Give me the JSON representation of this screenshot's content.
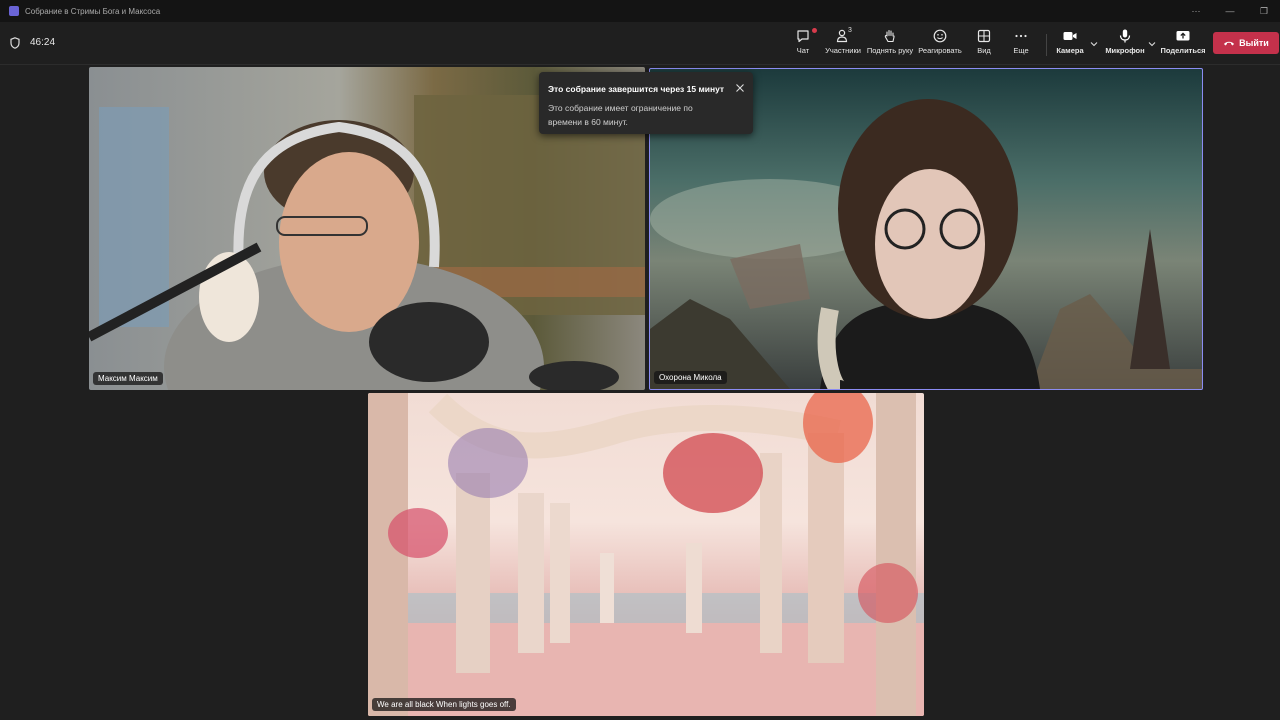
{
  "window": {
    "title": "Собрание в Стримы Бога и Максоса",
    "controls": [
      "···",
      "—",
      "❐"
    ]
  },
  "toolbar": {
    "timer": "46:24",
    "chat_label": "Чат",
    "participants_label": "Участники",
    "participants_count": "3",
    "raise_hand_label": "Поднять руку",
    "react_label": "Реагировать",
    "view_label": "Вид",
    "more_label": "Еще",
    "camera_label": "Камера",
    "mic_label": "Микрофон",
    "share_label": "Поделиться",
    "leave_label": "Выйти"
  },
  "notification": {
    "title": "Это собрание завершится через 15 минут",
    "body": "Это собрание имеет ограничение по времени в 60 минут."
  },
  "tiles": [
    {
      "name": "Максим Максим"
    },
    {
      "name": "Охорона Микола"
    },
    {
      "name": "We are all black When lights goes off."
    }
  ],
  "colors": {
    "accent": "#8b8cf2",
    "leave": "#c4314b",
    "background": "#1f1f1f"
  }
}
